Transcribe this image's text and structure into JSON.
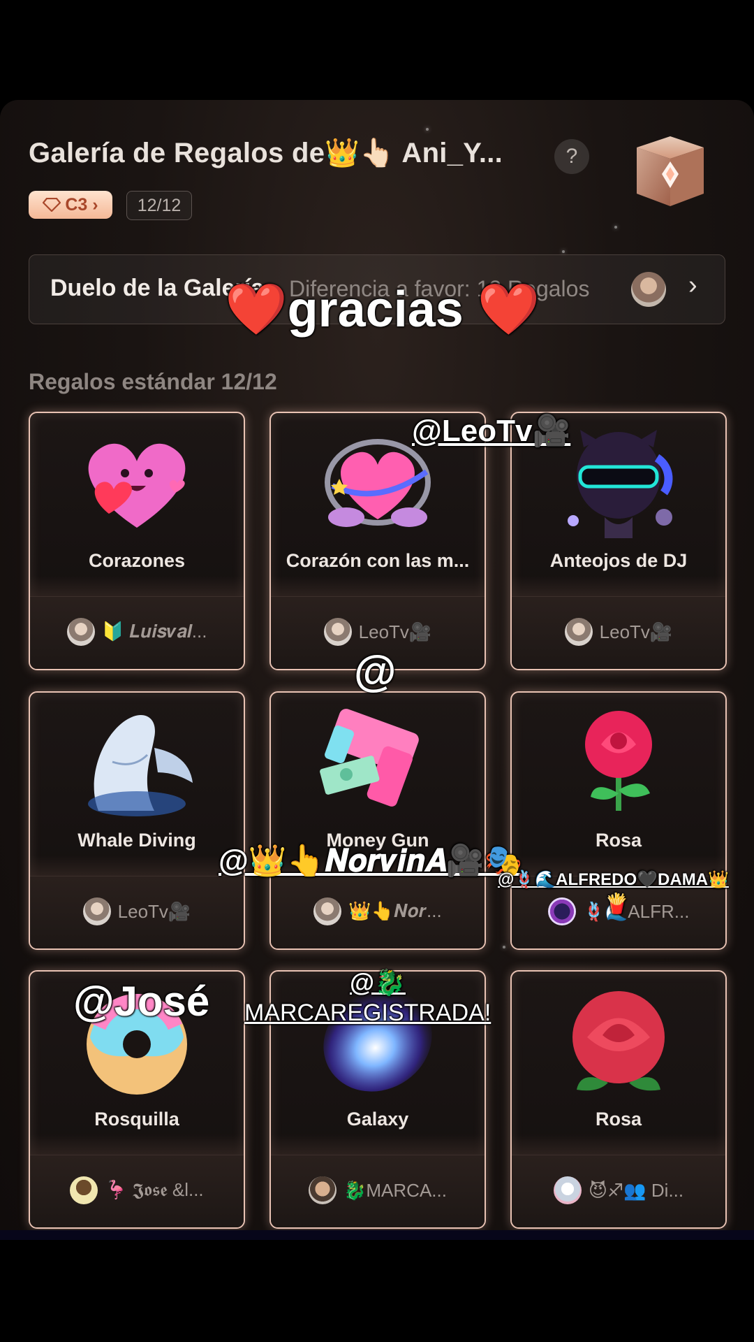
{
  "header": {
    "title": "Galería de Regalos de👑👆🏻 Ani_Y...",
    "help_label": "?",
    "level_badge": "C3 ›",
    "count_badge": "12/12"
  },
  "duel": {
    "title": "Duelo de la Galería",
    "difference": "Diferencia a favor: 12 Regalos",
    "chevron": "›"
  },
  "section": {
    "title": "Regalos estándar 12/12"
  },
  "gifts": [
    {
      "name": "Corazones",
      "sender": "🔰 𝑳𝒖𝒊𝒔𝒗𝒂𝒍...",
      "icon": "heart-character-icon"
    },
    {
      "name": "Corazón con las m...",
      "sender": "LeoTv🎥",
      "icon": "heart-hands-icon"
    },
    {
      "name": "Anteojos de DJ",
      "sender": "LeoTv🎥",
      "icon": "dj-glasses-icon"
    },
    {
      "name": "Whale Diving",
      "sender": "LeoTv🎥",
      "icon": "whale-icon"
    },
    {
      "name": "Money Gun",
      "sender": "👑👆𝑵𝒐𝒓...",
      "icon": "money-gun-icon"
    },
    {
      "name": "Rosa",
      "sender": "🪢🌊ALFR...",
      "icon": "rose-icon"
    },
    {
      "name": "Rosquilla",
      "sender": "🦩 𝕵𝖔𝖘𝖊 &l...",
      "icon": "donut-icon"
    },
    {
      "name": "Galaxy",
      "sender": "🐉MARCA...",
      "icon": "galaxy-icon"
    },
    {
      "name": "Rosa",
      "sender": "😈♐👥 Di...",
      "icon": "rose-icon"
    }
  ],
  "overlays": {
    "gracias": "❤️gracias ❤️",
    "mention_leo": "@LeoTv🎥",
    "mention_at": "@",
    "mention_norvina": "@👑👆𝑵𝒐𝒓𝒗𝒊𝒏𝑨🎥🎭",
    "mention_alfredo": "@🪢🌊ALFREDO🖤DAMA👑",
    "mention_alfredo_tag": "🍟",
    "mention_jose": "@José",
    "mention_marca_1": "@🐉",
    "mention_marca_2": "MARCAREGISTRADA!"
  },
  "colors": {
    "background": "#000000",
    "panel": "#1a1412",
    "card_border": "#e9c3b4",
    "badge_bg": "#f4b897",
    "badge_text": "#a8472a",
    "muted_text": "#8e8682"
  }
}
